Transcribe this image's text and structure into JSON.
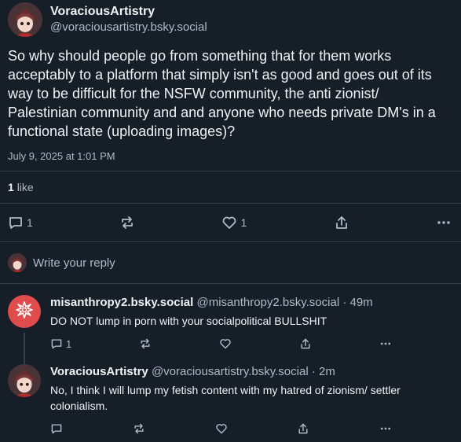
{
  "main_post": {
    "author": {
      "display_name": "VoraciousArtistry",
      "handle": "@voraciousartistry.bsky.social"
    },
    "text": "So why should people go from something that for them works acceptably to a platform that simply isn't as good and goes out of its way to be difficult for the NSFW community, the anti zionist/ Palestinian community and and anyone who needs private DM's in a functional state (uploading images)?",
    "timestamp": "July 9, 2025 at 1:01 PM",
    "likes": {
      "count": "1",
      "label": "like"
    },
    "actions": {
      "reply_count": "1",
      "like_count": "1"
    }
  },
  "reply_box": {
    "placeholder": "Write your reply"
  },
  "replies": [
    {
      "display_name": "misanthropy2.bsky.social",
      "handle": "@misanthropy2.bsky.social",
      "time": "· 49m",
      "text": "DO NOT lump in porn with your socialpolitical BULLSHIT",
      "reply_count": "1",
      "avatar_color": "#e04c4c"
    },
    {
      "display_name": "VoraciousArtistry",
      "handle": "@voraciousartistry.bsky.social",
      "time": "· 2m",
      "text": "No, I think I will lump my fetish content with my hatred of zionism/ settler colonialism.",
      "reply_count": ""
    }
  ],
  "colors": {
    "background": "#161e27",
    "text": "#f1f3f5",
    "muted": "#aebbc9",
    "divider": "#2e4052"
  },
  "icons": [
    "reply-icon",
    "repost-icon",
    "like-icon",
    "share-icon",
    "more-icon",
    "starburst-icon"
  ]
}
